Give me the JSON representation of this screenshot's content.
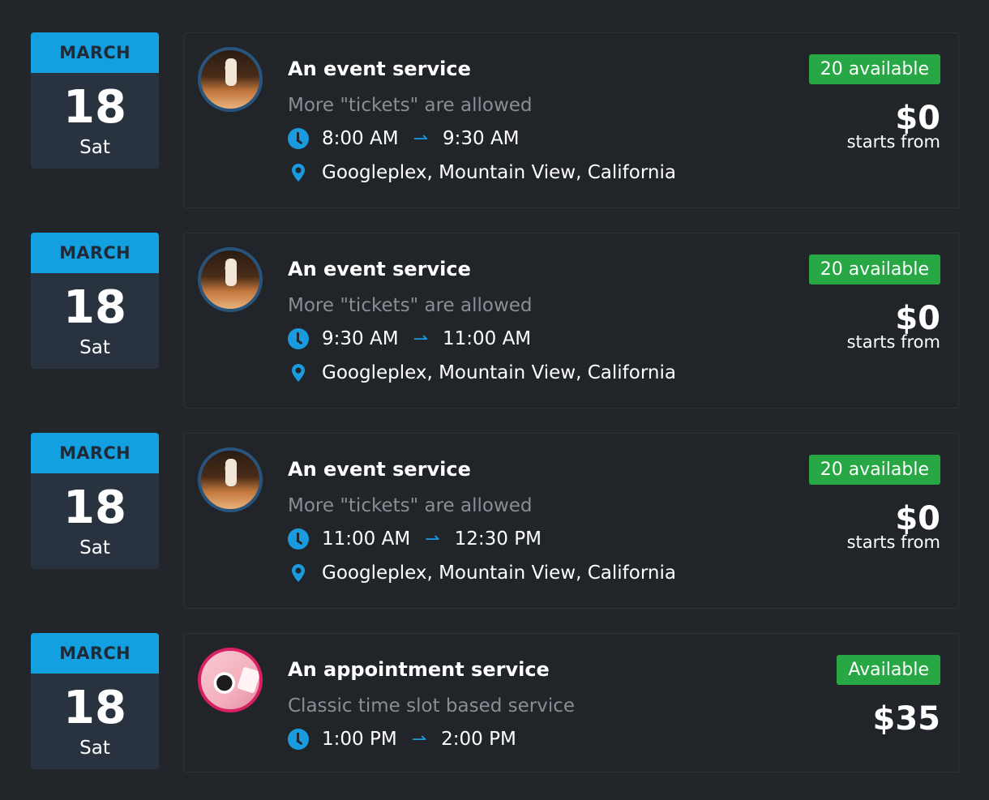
{
  "events": [
    {
      "month": "MARCH",
      "day": "18",
      "weekday": "Sat",
      "title": "An event service",
      "subtitle": "More \"tickets\" are allowed",
      "start": "8:00 AM",
      "end": "9:30 AM",
      "location": "Googleplex, Mountain View, California",
      "availability": "20 available",
      "price": "$0",
      "price_note": "starts from",
      "thumb_icon": "concert-photo"
    },
    {
      "month": "MARCH",
      "day": "18",
      "weekday": "Sat",
      "title": "An event service",
      "subtitle": "More \"tickets\" are allowed",
      "start": "9:30 AM",
      "end": "11:00 AM",
      "location": "Googleplex, Mountain View, California",
      "availability": "20 available",
      "price": "$0",
      "price_note": "starts from",
      "thumb_icon": "concert-photo"
    },
    {
      "month": "MARCH",
      "day": "18",
      "weekday": "Sat",
      "title": "An event service",
      "subtitle": "More \"tickets\" are allowed",
      "start": "11:00 AM",
      "end": "12:30 PM",
      "location": "Googleplex, Mountain View, California",
      "availability": "20 available",
      "price": "$0",
      "price_note": "starts from",
      "thumb_icon": "concert-photo"
    },
    {
      "month": "MARCH",
      "day": "18",
      "weekday": "Sat",
      "title": "An appointment service",
      "subtitle": "Classic time slot based service",
      "start": "1:00 PM",
      "end": "2:00 PM",
      "availability": "Available",
      "price": "$35",
      "thumb_icon": "alarm-clock-photo"
    }
  ],
  "arrow_glyph": "⇀",
  "colors": {
    "background": "#222529",
    "accent_blue": "#13a0e0",
    "badge_green": "#28a745",
    "muted_text": "#8a8e94",
    "event_ring": "#28547c",
    "appointment_ring": "#d91f63"
  }
}
